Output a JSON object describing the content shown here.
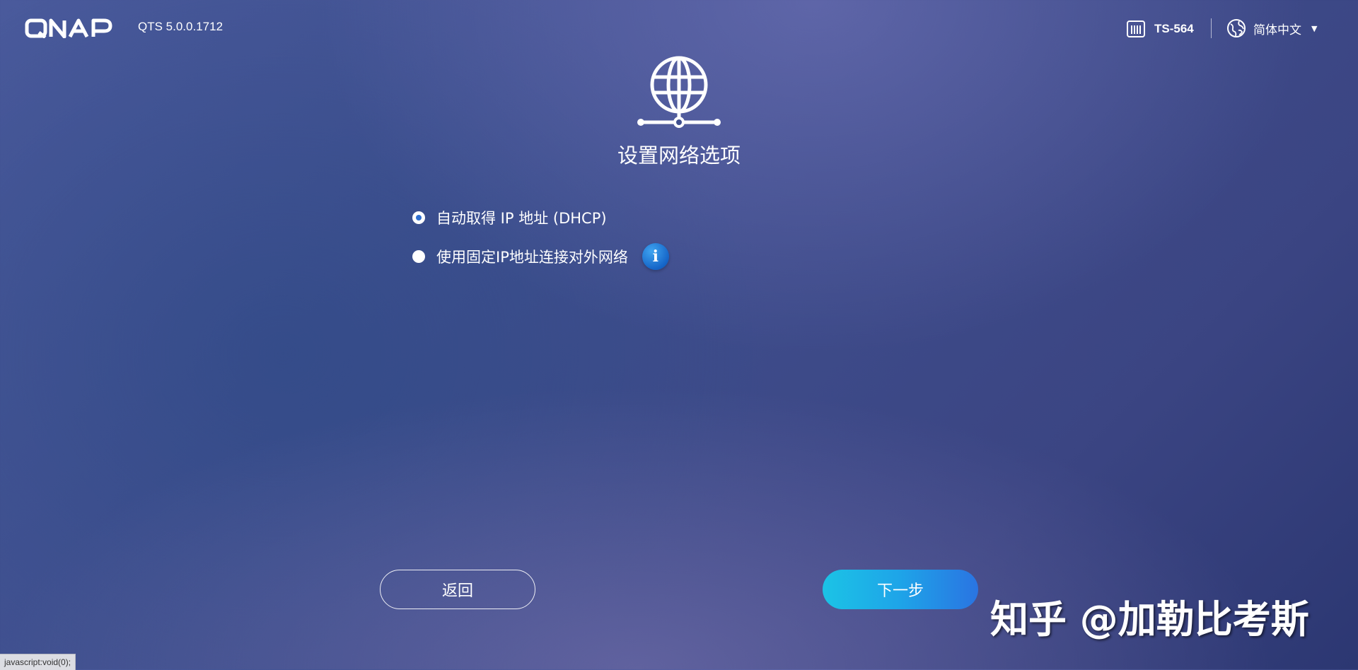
{
  "header": {
    "logo_text": "QNAP",
    "version": "QTS 5.0.0.1712",
    "model": "TS-564",
    "language": "简体中文",
    "model_icon": "nas-device-icon",
    "language_icon": "globe-icon",
    "caret_icon": "caret-down-icon"
  },
  "main": {
    "hero_icon": "network-globe-icon",
    "title": "设置网络选项",
    "options": [
      {
        "label": "自动取得 IP 地址 (DHCP)",
        "selected": true
      },
      {
        "label": "使用固定IP地址连接对外网络",
        "selected": false
      }
    ],
    "info_glyph": "i"
  },
  "footer": {
    "back_label": "返回",
    "next_label": "下一步"
  },
  "watermark": "知乎 @加勒比考斯",
  "statusbar": "javascript:void(0);",
  "colors": {
    "background": "#3f4f8e",
    "radio_dot": "#2f6fd0",
    "next_start": "#1cc3e6",
    "next_end": "#2a74e2",
    "info": "#1565c8"
  }
}
